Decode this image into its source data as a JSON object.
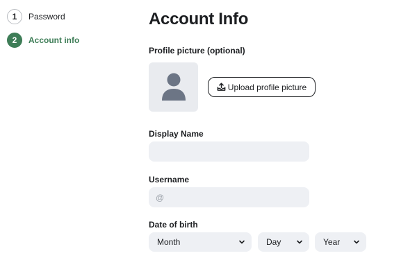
{
  "stepper": {
    "steps": [
      {
        "number": "1",
        "label": "Password",
        "state": "inactive"
      },
      {
        "number": "2",
        "label": "Account info",
        "state": "active"
      }
    ],
    "active_color": "#3e7d57"
  },
  "main": {
    "title": "Account Info",
    "profile_picture": {
      "label": "Profile picture (optional)",
      "avatar_icon": "user-silhouette-icon",
      "upload_button_label": "Upload profile picture",
      "upload_icon": "upload-tray-icon"
    },
    "display_name": {
      "label": "Display Name",
      "value": "",
      "placeholder": ""
    },
    "username": {
      "label": "Username",
      "value": "",
      "placeholder": "@"
    },
    "date_of_birth": {
      "label": "Date of birth",
      "month": "Month",
      "day": "Day",
      "year": "Year",
      "dropdown_icon": "chevron-down-icon"
    }
  }
}
